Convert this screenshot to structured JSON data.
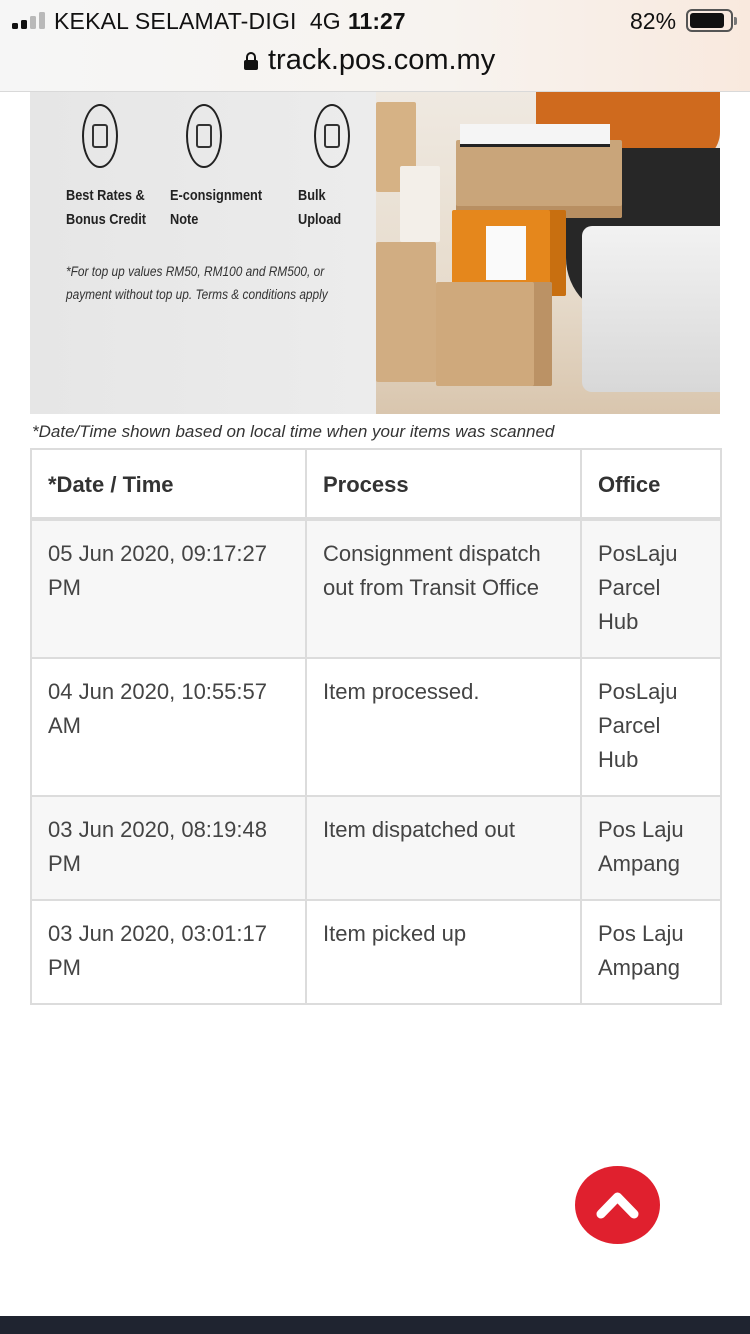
{
  "status_bar": {
    "carrier": "KEKAL SELAMAT-DIGI",
    "network": "4G",
    "time": "11:27",
    "battery": "82%"
  },
  "browser": {
    "url": "track.pos.com.my"
  },
  "banner": {
    "features": [
      {
        "label": "Best Rates &\nBonus Credit",
        "icon": "money-hand-icon"
      },
      {
        "label": "E-consignment\nNote",
        "icon": "document-scan-icon"
      },
      {
        "label": "Bulk\nUpload",
        "icon": "upload-file-icon"
      }
    ],
    "footnote": "*For top up values RM50, RM100 and RM500, or payment without top up. Terms & conditions apply"
  },
  "time_note": "*Date/Time shown based on local time when your items was scanned",
  "table": {
    "headers": [
      "*Date / Time",
      "Process",
      "Office"
    ],
    "rows": [
      [
        "05 Jun 2020, 09:17:27 PM",
        "Consignment dispatch out from Transit Office",
        "PosLaju Parcel Hub"
      ],
      [
        "04 Jun 2020, 10:55:57 AM",
        "Item processed.",
        "PosLaju Parcel Hub"
      ],
      [
        "03 Jun 2020, 08:19:48 PM",
        "Item dispatched out",
        "Pos Laju Ampang"
      ],
      [
        "03 Jun 2020, 03:01:17 PM",
        "Item picked up",
        "Pos Laju Ampang"
      ]
    ]
  },
  "colors": {
    "scroll_top_button": "#e0202e",
    "footer": "#1f2430"
  },
  "icons": {
    "scroll_top": "chevron-up-icon",
    "lock": "lock-icon"
  }
}
